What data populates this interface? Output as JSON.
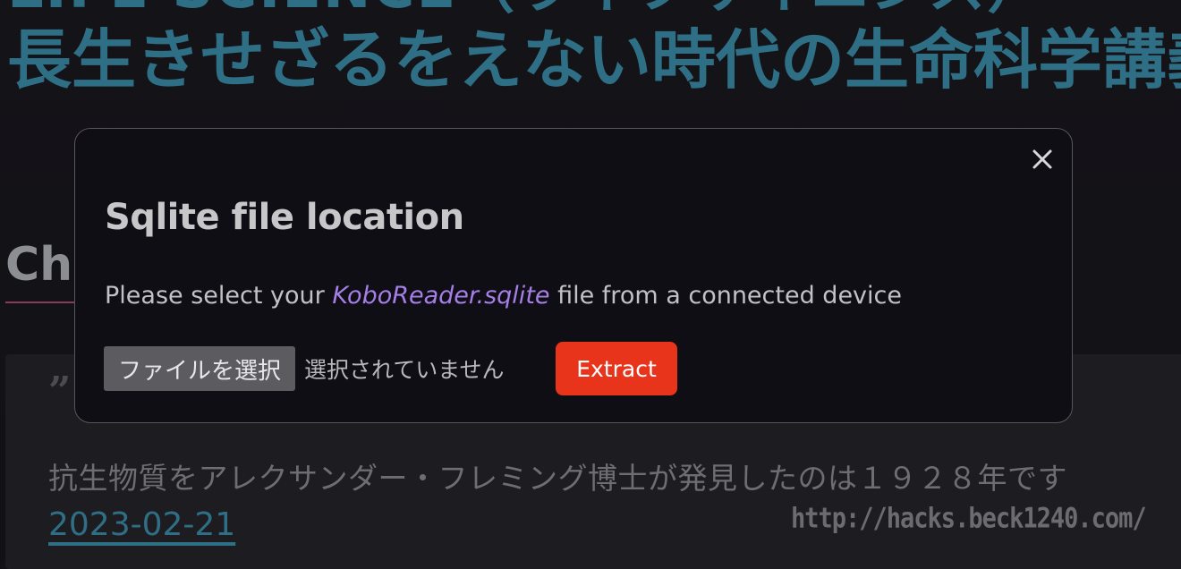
{
  "background_page": {
    "book_title_top_fragment": "LIFE SCIENCE（ライフサイエンス）",
    "book_title": "長生きせざるをえない時代の生命科学講義",
    "section_heading": "Ch",
    "quote_mark": "”",
    "quote_text": "抗生物質をアレクサンダー・フレミング博士が発見したのは１９２８年です",
    "quote_date": "2023-02-21",
    "watermark": "http://hacks.beck1240.com/"
  },
  "modal": {
    "close_icon": "close-icon",
    "title": "Sqlite file location",
    "description_before": "Please select your ",
    "description_filename": "KoboReader.sqlite",
    "description_after": " file from a connected device",
    "file_choose_label": "ファイルを選択",
    "file_status": "選択されていません",
    "extract_label": "Extract"
  },
  "colors": {
    "background": "#131217",
    "accent_title": "#2f6f85",
    "modal_background": "#0f0e15",
    "filename_highlight": "#a57fe6",
    "extract_button": "#e8341b"
  }
}
